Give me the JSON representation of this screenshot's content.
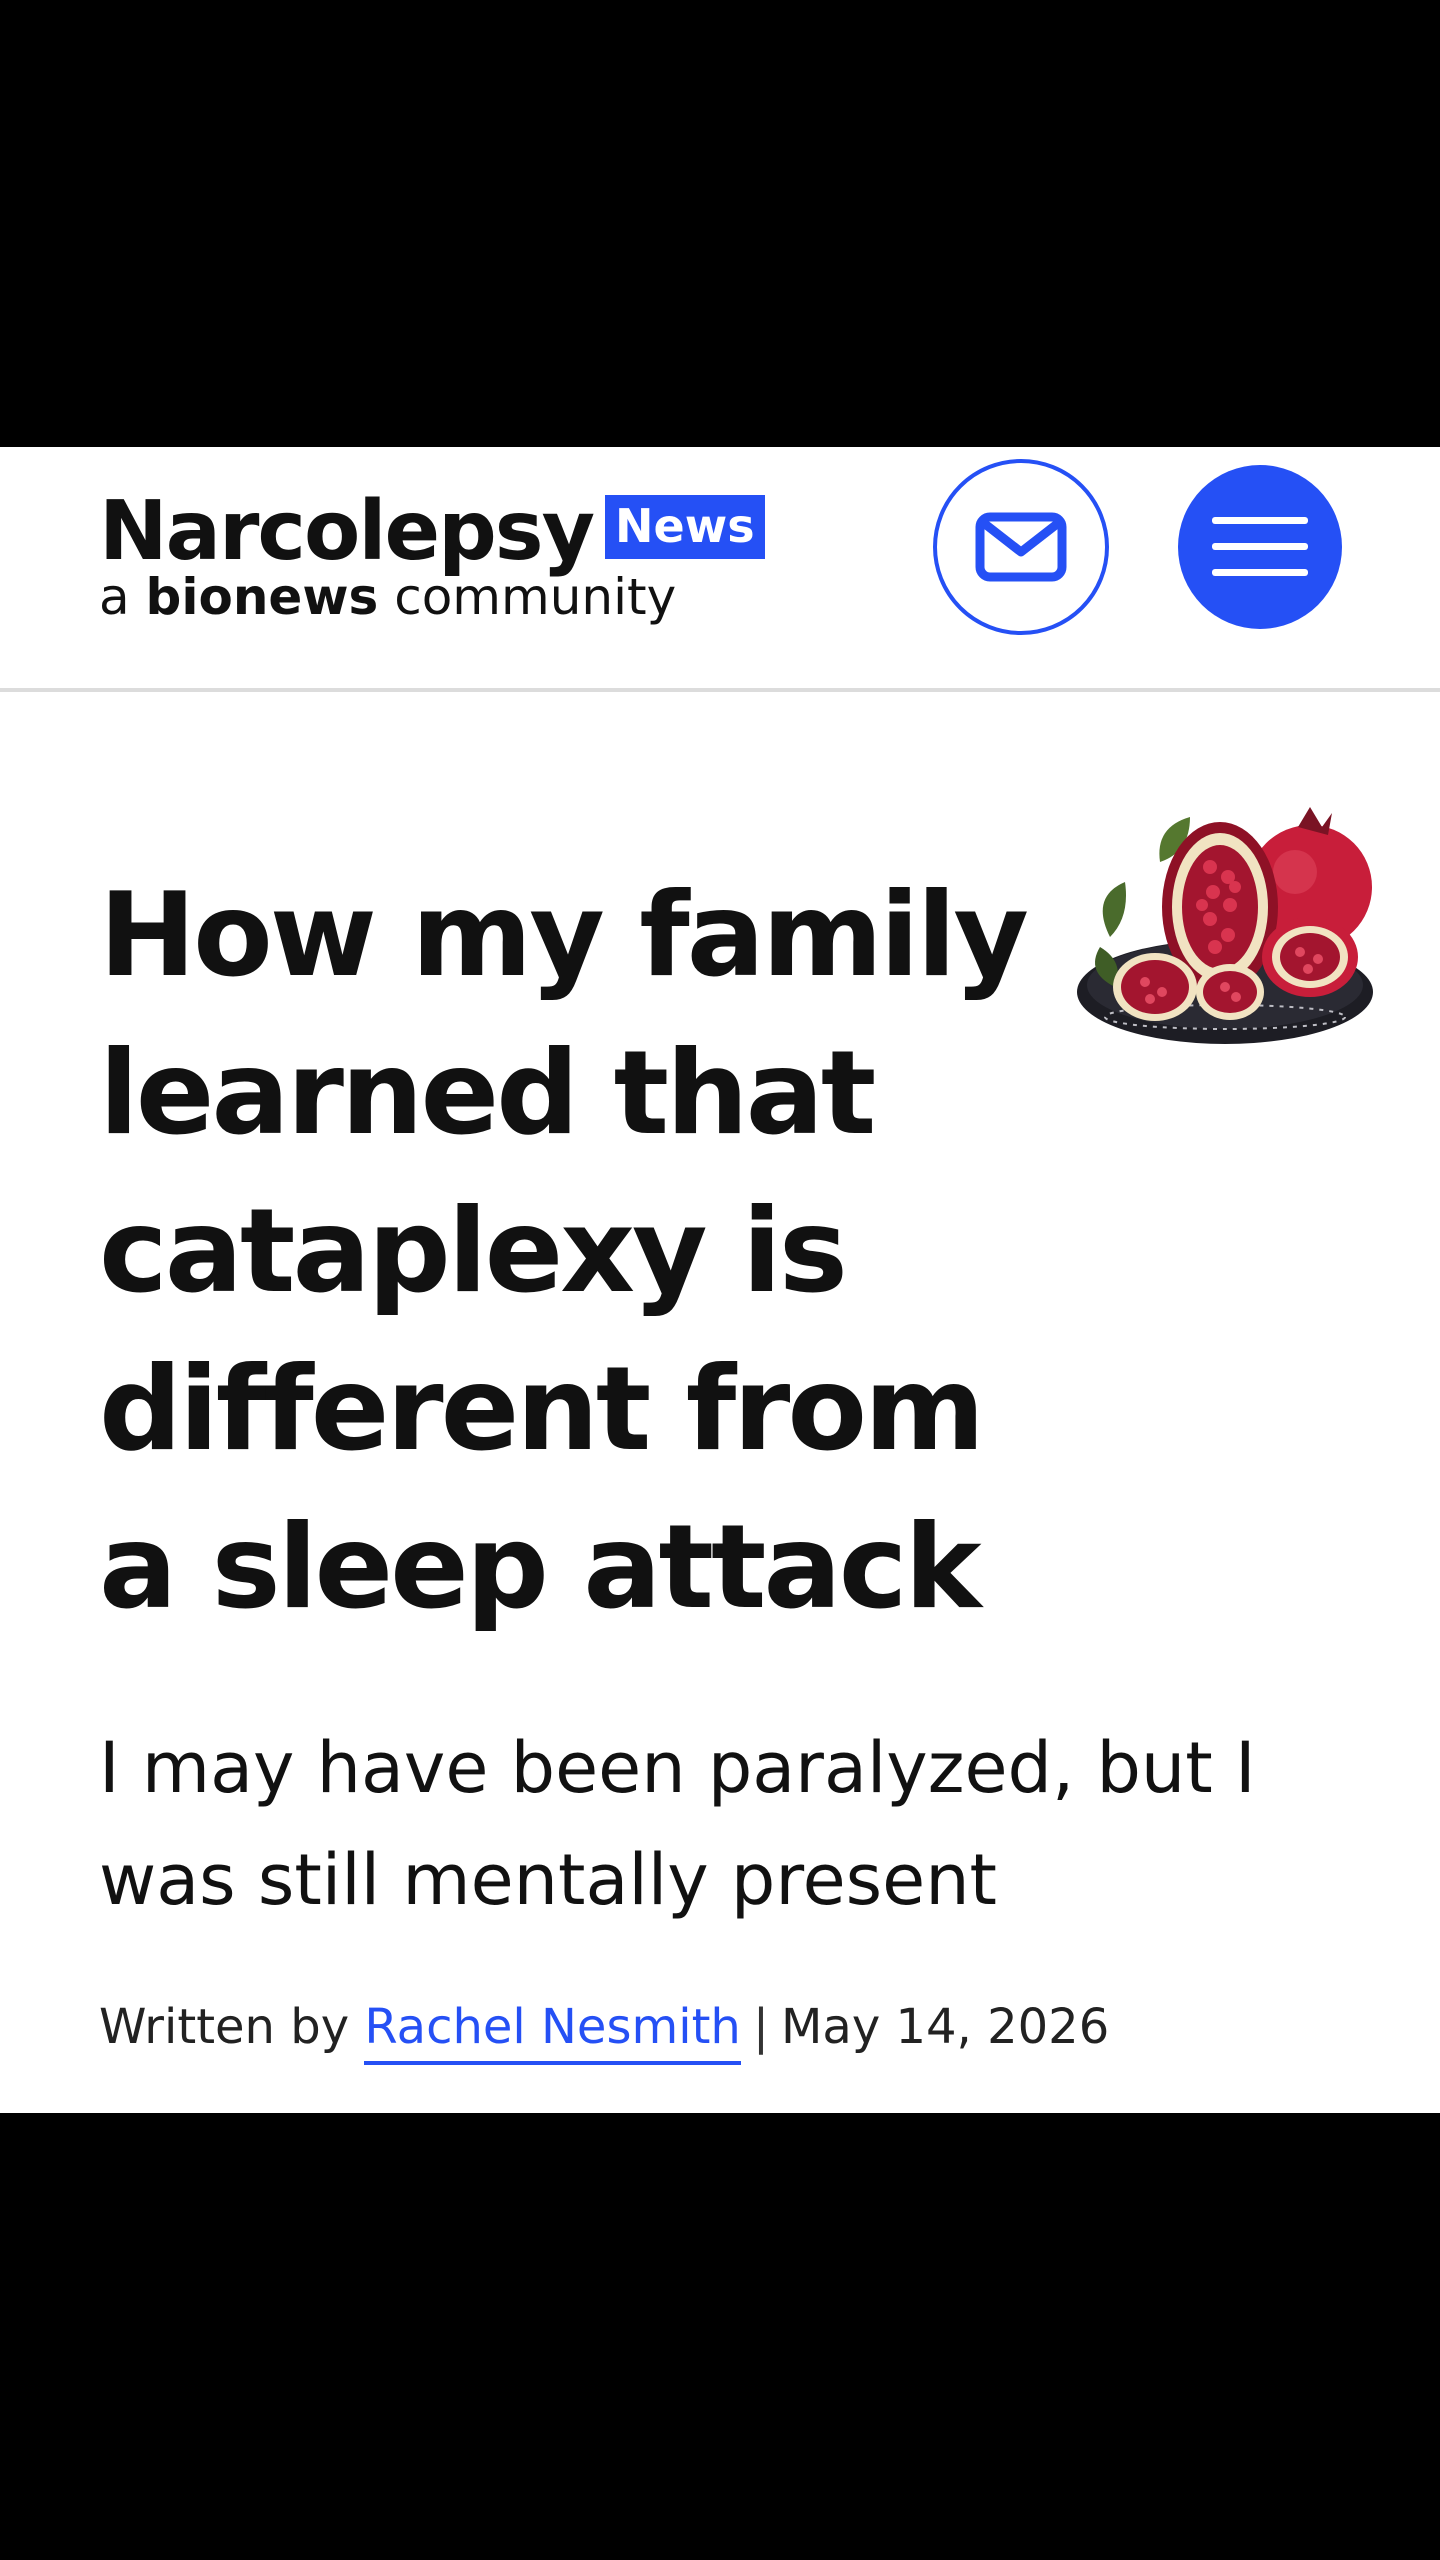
{
  "header": {
    "brand_name": "Narcolepsy",
    "brand_badge": "News",
    "tagline_prefix": "a",
    "tagline_brand": "bionews",
    "tagline_suffix": "community",
    "mail_icon": "envelope-icon",
    "menu_icon": "hamburger-menu-icon",
    "accent_color": "#2550f5"
  },
  "article": {
    "title": "How my family learned that cataplexy is different from a sleep attack",
    "subtitle": "I may have been paralyzed, but I was still mentally present",
    "byline_prefix": "Written by",
    "author": "Rachel Nesmith",
    "separator": "|",
    "date": "May 14, 2026",
    "hero_icon": "pomegranate-illustration"
  }
}
